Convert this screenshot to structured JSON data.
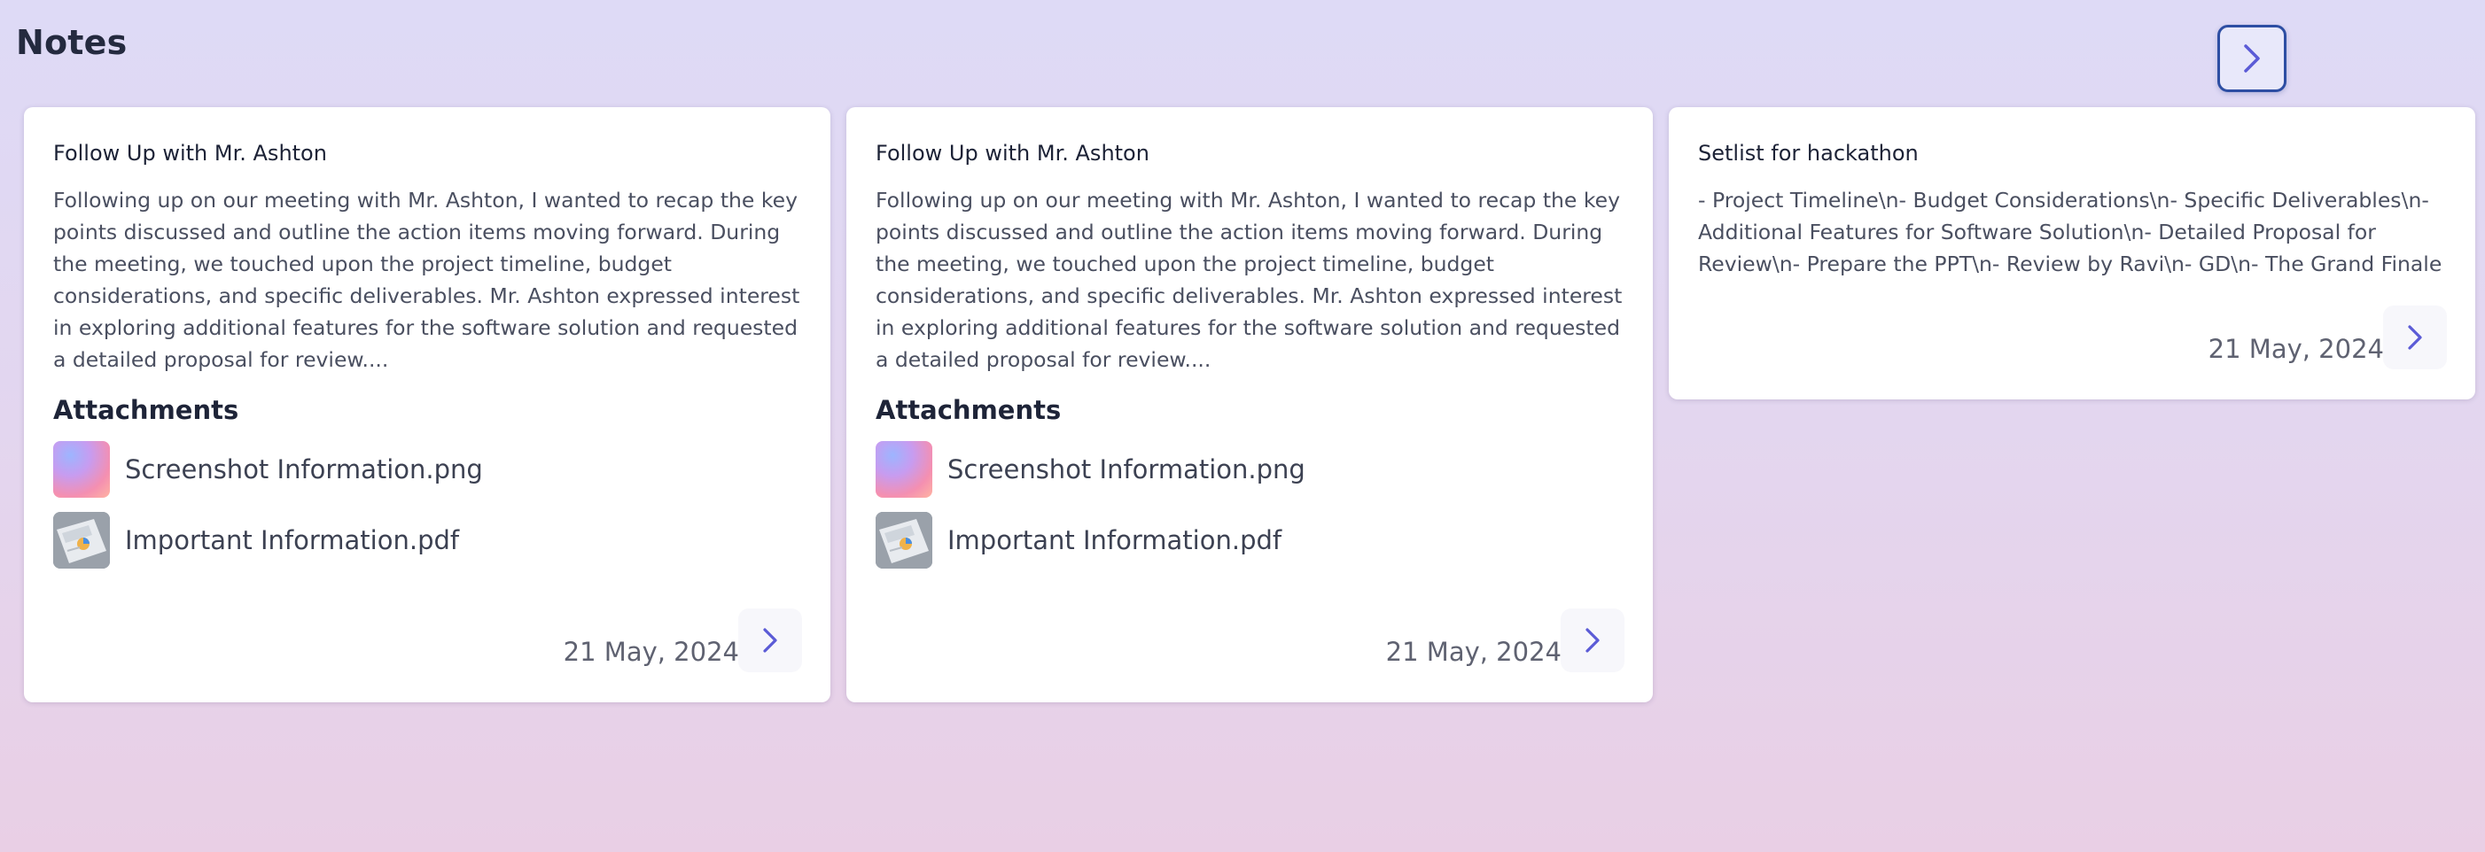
{
  "page": {
    "title": "Notes"
  },
  "colors": {
    "accent": "#5b5bd6",
    "focus_border": "#2d4ea3"
  },
  "header": {
    "next_icon": "chevron-right-icon"
  },
  "notes": [
    {
      "title": "Follow Up with Mr. Ashton",
      "body": "Following up on our meeting with Mr. Ashton, I wanted to recap the key points discussed and outline the action items moving forward. During the meeting, we touched upon the project timeline, budget considerations, and specific deliverables. Mr. Ashton expressed interest in exploring additional features for the software solution and requested a detailed proposal for review....",
      "attachments_heading": "Attachments",
      "attachments": [
        {
          "name": "Screenshot Information.png",
          "icon": "image-thumbnail"
        },
        {
          "name": "Important Information.pdf",
          "icon": "document-thumbnail"
        }
      ],
      "date": "21 May, 2024"
    },
    {
      "title": "Follow Up with Mr. Ashton",
      "body": "Following up on our meeting with Mr. Ashton, I wanted to recap the key points discussed and outline the action items moving forward. During the meeting, we touched upon the project timeline, budget considerations, and specific deliverables. Mr. Ashton expressed interest in exploring additional features for the software solution and requested a detailed proposal for review....",
      "attachments_heading": "Attachments",
      "attachments": [
        {
          "name": "Screenshot Information.png",
          "icon": "image-thumbnail"
        },
        {
          "name": "Important Information.pdf",
          "icon": "document-thumbnail"
        }
      ],
      "date": "21 May, 2024"
    },
    {
      "title": "Setlist for hackathon",
      "body": "- Project Timeline\\n- Budget Considerations\\n- Specific Deliverables\\n- Additional Features for Software Solution\\n- Detailed Proposal for Review\\n- Prepare the PPT\\n- Review by Ravi\\n- GD\\n- The Grand Finale",
      "date": "21 May, 2024"
    }
  ]
}
